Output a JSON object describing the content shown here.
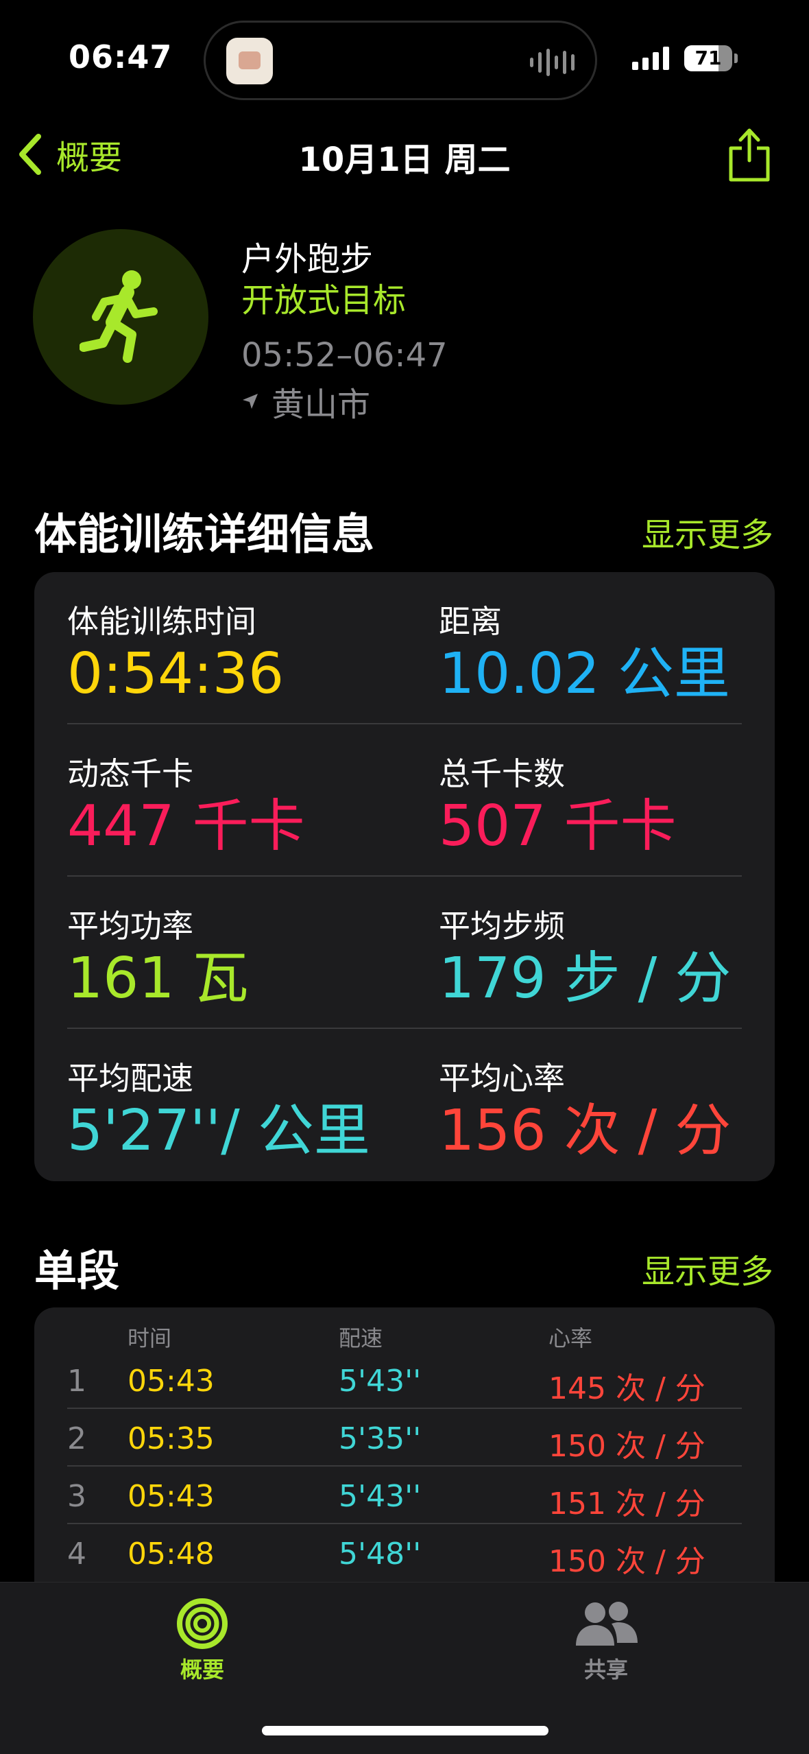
{
  "status_bar": {
    "time": "06:47",
    "battery": "71",
    "battery_level_percent": 71
  },
  "nav": {
    "back_label": "概要",
    "title": "10月1日 周二",
    "icons": {
      "back": "chevron-left-icon",
      "share": "share-icon"
    }
  },
  "workout": {
    "type": "户外跑步",
    "goal": "开放式目标",
    "time_range": "05:52–06:47",
    "location": "黄山市",
    "icons": {
      "activity": "running-icon",
      "location": "location-arrow-icon"
    }
  },
  "details": {
    "title": "体能训练详细信息",
    "show_more": "显示更多",
    "metrics": [
      {
        "label": "体能训练时间",
        "value": "0:54:36",
        "color": "#ffd60a"
      },
      {
        "label": "距离",
        "value": "10.02 公里",
        "color": "#1fb2f5"
      },
      {
        "label": "动态千卡",
        "value": "447 千卡",
        "color": "#fa1d5a"
      },
      {
        "label": "总千卡数",
        "value": "507 千卡",
        "color": "#fa1d5a"
      },
      {
        "label": "平均功率",
        "value": "161 瓦",
        "color": "#a8e82b"
      },
      {
        "label": "平均步频",
        "value": "179 步 / 分",
        "color": "#40d6d6"
      },
      {
        "label": "平均配速",
        "value": "5'27''/ 公里",
        "color": "#40d6d6"
      },
      {
        "label": "平均心率",
        "value": "156 次 / 分",
        "color": "#ff453a"
      }
    ]
  },
  "splits": {
    "title": "单段",
    "show_more": "显示更多",
    "columns": [
      "时间",
      "配速",
      "心率"
    ],
    "rows": [
      {
        "num": "1",
        "time": "05:43",
        "pace": "5'43''",
        "hr": "145 次 / 分"
      },
      {
        "num": "2",
        "time": "05:35",
        "pace": "5'35''",
        "hr": "150 次 / 分"
      },
      {
        "num": "3",
        "time": "05:43",
        "pace": "5'43''",
        "hr": "151 次 / 分"
      },
      {
        "num": "4",
        "time": "05:48",
        "pace": "5'48''",
        "hr": "150 次 / 分"
      }
    ]
  },
  "tabs": [
    {
      "label": "概要",
      "icon": "activity-rings-icon",
      "active": true
    },
    {
      "label": "共享",
      "icon": "people-icon",
      "active": false
    }
  ],
  "colors": {
    "accent": "#a8e82b",
    "card_bg": "#1c1c1e",
    "secondary_text": "#8a8a8e"
  }
}
